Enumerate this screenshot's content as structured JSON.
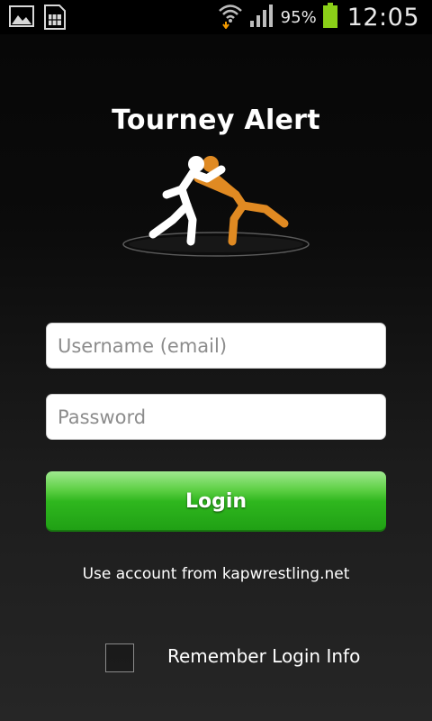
{
  "status_bar": {
    "battery_percent": "95%",
    "time": "12:05",
    "icons": [
      "gallery-icon",
      "sim-card-icon",
      "wifi-icon",
      "signal-icon",
      "battery-icon"
    ]
  },
  "app": {
    "title": "Tourney Alert",
    "logo_icon": "wrestlers-icon"
  },
  "login_form": {
    "username_placeholder": "Username (email)",
    "username_value": "",
    "password_placeholder": "Password",
    "password_value": "",
    "login_label": "Login",
    "account_note": "Use account from kapwrestling.net",
    "remember_label": "Remember Login Info",
    "remember_checked": false
  },
  "colors": {
    "accent_green": "#2fb71e",
    "logo_orange": "#e08a22"
  }
}
